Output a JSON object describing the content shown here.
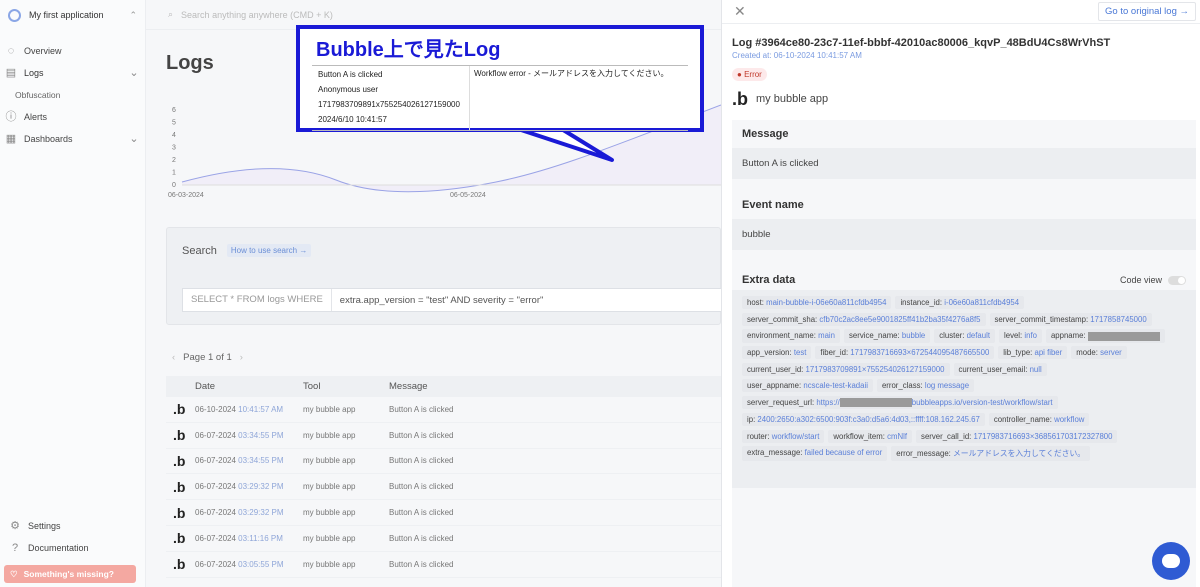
{
  "sidebar": {
    "app_name": "My first application",
    "items": [
      {
        "label": "Overview"
      },
      {
        "label": "Logs"
      },
      {
        "label": "Alerts"
      },
      {
        "label": "Dashboards"
      }
    ],
    "sub_item": "Obfuscation",
    "settings": "Settings",
    "documentation": "Documentation",
    "missing": "Something's missing?"
  },
  "topbar": {
    "search_placeholder": "Search anything anywhere (CMD + K)"
  },
  "page": {
    "title": "Logs"
  },
  "chart_data": {
    "type": "area",
    "x_ticks": [
      "06-03-2024",
      "06-05-2024"
    ],
    "y_ticks": [
      "0",
      "1",
      "2",
      "3",
      "4",
      "5",
      "6"
    ],
    "ylim": [
      0,
      6
    ]
  },
  "query": {
    "title": "Search",
    "help": "How to use search",
    "prefix": "SELECT * FROM logs WHERE",
    "value": "extra.app_version = \"test\" AND severity = \"error\""
  },
  "pager": {
    "text": "Page 1 of 1"
  },
  "table": {
    "headers": [
      "Date",
      "Tool",
      "Message"
    ],
    "rows": [
      {
        "date": "06-10-2024",
        "time": "10:41:57 AM",
        "tool": "my bubble app",
        "msg": "Button A is clicked"
      },
      {
        "date": "06-07-2024",
        "time": "03:34:55 PM",
        "tool": "my bubble app",
        "msg": "Button A is clicked"
      },
      {
        "date": "06-07-2024",
        "time": "03:34:55 PM",
        "tool": "my bubble app",
        "msg": "Button A is clicked"
      },
      {
        "date": "06-07-2024",
        "time": "03:29:32 PM",
        "tool": "my bubble app",
        "msg": "Button A is clicked"
      },
      {
        "date": "06-07-2024",
        "time": "03:29:32 PM",
        "tool": "my bubble app",
        "msg": "Button A is clicked"
      },
      {
        "date": "06-07-2024",
        "time": "03:11:16 PM",
        "tool": "my bubble app",
        "msg": "Button A is clicked"
      },
      {
        "date": "06-07-2024",
        "time": "03:05:55 PM",
        "tool": "my bubble app",
        "msg": "Button A is clicked"
      }
    ]
  },
  "panel": {
    "original_link": "Go to original log →",
    "log_id": "Log #3964ce80-23c7-11ef-bbbf-42010ac80006_kqvP_48BdU4Cs8WrVhST",
    "created": "Created at: 06-10-2024 10:41:57 AM",
    "badge": "Error",
    "app": "my bubble app",
    "message_title": "Message",
    "message": "Button A is clicked",
    "event_title": "Event name",
    "event": "bubble",
    "extra_title": "Extra data",
    "code_view": "Code view",
    "extra_rows": [
      [
        {
          "k": "host: ",
          "v": "main-bubble-i-06e60a811cfdb4954"
        },
        {
          "k": "instance_id: ",
          "v": "i-06e60a811cfdb4954"
        }
      ],
      [
        {
          "k": "server_commit_sha: ",
          "v": "cfb70c2ac8ee5e9001825ff41b2ba35f4276a8f5"
        },
        {
          "k": "server_commit_timestamp: ",
          "v": "1717858745000"
        }
      ],
      [
        {
          "k": "environment_name: ",
          "v": "main"
        },
        {
          "k": "service_name: ",
          "v": "bubble"
        },
        {
          "k": "cluster: ",
          "v": "default"
        },
        {
          "k": "level: ",
          "v": "info"
        },
        {
          "k": "appname: ",
          "v": ""
        }
      ],
      [
        {
          "k": "app_version: ",
          "v": "test"
        },
        {
          "k": "fiber_id: ",
          "v": "1717983716693×672544095487665500"
        },
        {
          "k": "lib_type: ",
          "v": "api fiber"
        },
        {
          "k": "mode: ",
          "v": "server"
        }
      ],
      [
        {
          "k": "current_user_id: ",
          "v": "1717983709891×755254026127159000"
        },
        {
          "k": "current_user_email: ",
          "v": "null"
        }
      ],
      [
        {
          "k": "user_appname: ",
          "v": "ncscale-test-kadaii"
        },
        {
          "k": "error_class: ",
          "v": "log message"
        }
      ],
      [
        {
          "k": "server_request_url: ",
          "v": "https://"
        }
      ],
      [
        {
          "k": "ip: ",
          "v": "2400:2650:a302:6500:903f:c3a0:d5a6:4d03,::ffff:108.162.245.67"
        },
        {
          "k": "controller_name: ",
          "v": "workflow"
        }
      ],
      [
        {
          "k": "router: ",
          "v": "workflow/start"
        },
        {
          "k": "workflow_item: ",
          "v": "cmNlf"
        },
        {
          "k": "server_call_id: ",
          "v": "1717983716693×368561703172327800"
        }
      ],
      [
        {
          "k": "extra_message: ",
          "v": "failed because of error"
        },
        {
          "k": "error_message: ",
          "v": "メールアドレスを入力してください。"
        }
      ]
    ],
    "url_suffix": "bubbleapps.io/version-test/workflow/start"
  },
  "callout": {
    "title": "Bubble上で見たLog",
    "left_lines": [
      "Button A is clicked",
      "Anonymous user",
      "1717983709891x755254026127159000",
      "2024/6/10 10:41:57"
    ],
    "right_text": "Workflow error - メールアドレスを入力してください。"
  }
}
